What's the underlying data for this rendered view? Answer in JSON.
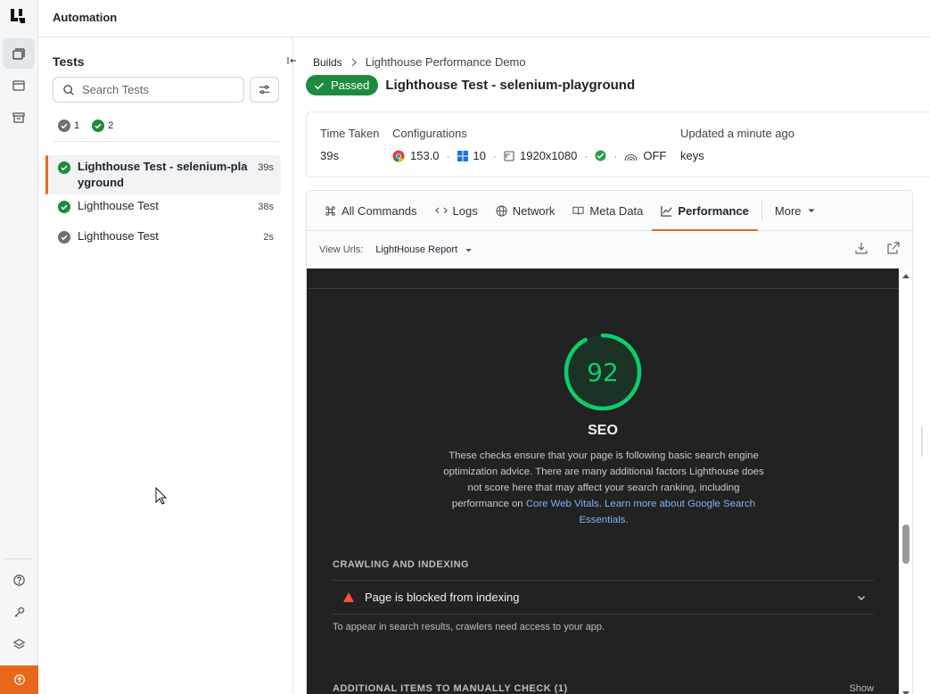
{
  "app": {
    "title": "Automation"
  },
  "tests_panel": {
    "heading": "Tests",
    "search_placeholder": "Search Tests",
    "counts": [
      {
        "status": "completed",
        "value": "1",
        "color": "#6b7076"
      },
      {
        "status": "passed",
        "value": "2",
        "color": "#1e8a3e"
      }
    ],
    "items": [
      {
        "name": "Lighthouse Test - selenium-playground",
        "duration": "39s",
        "status": "passed",
        "selected": true
      },
      {
        "name": "Lighthouse Test",
        "duration": "38s",
        "status": "passed",
        "selected": false
      },
      {
        "name": "Lighthouse Test",
        "duration": "2s",
        "status": "completed",
        "selected": false
      }
    ]
  },
  "breadcrumb": {
    "root": "Builds",
    "current": "Lighthouse Performance Demo"
  },
  "build": {
    "status_label": "Passed",
    "title": "Lighthouse Test - selenium-playground"
  },
  "info": {
    "time_taken_label": "Time Taken",
    "time_taken": "39s",
    "configurations_label": "Configurations",
    "browser_version": "153.0",
    "os_version": "10",
    "resolution": "1920x1080",
    "tunnel": "OFF",
    "updated_label": "Updated a minute ago",
    "tags": "keys"
  },
  "tabs": [
    {
      "label": "All Commands",
      "icon": "command-icon"
    },
    {
      "label": "Logs",
      "icon": "code-icon"
    },
    {
      "label": "Network",
      "icon": "globe-icon"
    },
    {
      "label": "Meta Data",
      "icon": "book-icon"
    },
    {
      "label": "Performance",
      "icon": "chart-icon",
      "active": true
    }
  ],
  "more_label": "More",
  "view_urls": {
    "label": "View Urls:",
    "selected": "LightHouse Report"
  },
  "report": {
    "score": "92",
    "score_fraction": 0.92,
    "score_color": "#0cce6b",
    "category": "SEO",
    "desc_prefix": "These checks ensure that your page is following basic search engine optimization advice. There are many additional factors Lighthouse does not score here that may affect your search ranking, including performance on ",
    "link1": "Core Web Vitals",
    "desc_mid": ". ",
    "link2": "Learn more about Google Search Essentials",
    "desc_suffix": ".",
    "crawl_heading": "CRAWLING AND INDEXING",
    "audit_title": "Page is blocked from indexing",
    "audit_desc": "To appear in search results, crawlers need access to your app.",
    "additional_heading": "ADDITIONAL ITEMS TO MANUALLY CHECK (1)",
    "show_label": "Show"
  }
}
